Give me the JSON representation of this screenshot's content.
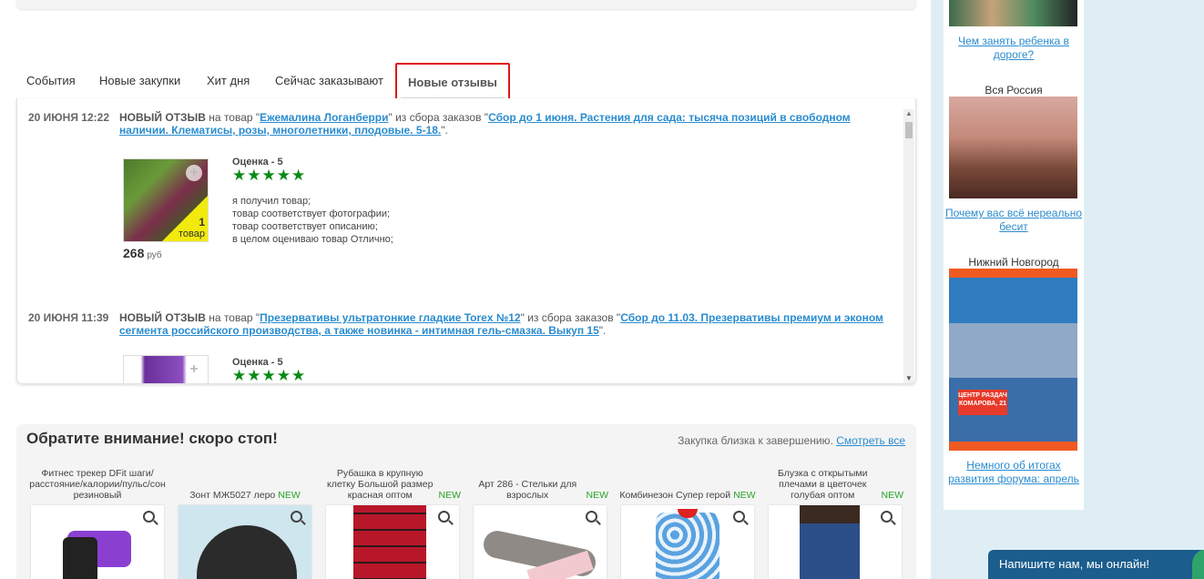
{
  "tabs": [
    {
      "label": "События"
    },
    {
      "label": "Новые закупки"
    },
    {
      "label": "Хит дня"
    },
    {
      "label": "Сейчас заказывают"
    },
    {
      "label": "Новые отзывы",
      "active": true
    }
  ],
  "reviews": [
    {
      "date": "20 ИЮНЯ 12:22",
      "prefix": "НОВЫЙ ОТЗЫВ",
      "on_product": " на товар \"",
      "product": "Ежемалина Логанберри",
      "from_collection": "\" из сбора заказов \"",
      "collection": "Сбор до 1 июня. Растения для сада: тысяча позиций в свободном наличии. Клематисы, розы, многолетники, плодовые. 5-18.",
      "end": "\".",
      "rating_label": "Оценка - 5",
      "stars": "★★★★★",
      "badge_count": "1",
      "badge_unit": "товар",
      "price": "268",
      "currency": "руб",
      "lines": [
        "я получил товар;",
        "товар соответствует фотографии;",
        "товар соответствует описанию;",
        "в целом оцениваю товар Отлично;"
      ]
    },
    {
      "date": "20 ИЮНЯ 11:39",
      "prefix": "НОВЫЙ ОТЗЫВ",
      "on_product": " на товар \"",
      "product": "Презервативы ультратонкие гладкие Torex №12",
      "from_collection": "\" из сбора заказов \"",
      "collection": "Сбор до 11.03. Презервативы премиум и эконом сегмента российского производства, а также новинка - интимная гель-смазка. Выкуп 15",
      "end": "\".",
      "rating_label": "Оценка - 5",
      "stars": "★★★★★"
    }
  ],
  "stop_section": {
    "title": "Обратите внимание! скоро стоп!",
    "hint": "Закупка близка к завершению.",
    "hint_link": "Смотреть все",
    "new_label": "NEW",
    "cards": [
      {
        "caption": "Фитнес трекер DFit шаги/расстояние/калории/пульс/сон резиновый",
        "is_new": false,
        "color": "#8a3fd1"
      },
      {
        "caption": "Зонт МЖ5027 леро",
        "is_new": true,
        "color": "#2b2b2b"
      },
      {
        "caption": "Рубашка в крупную клетку Большой размер красная оптом",
        "is_new": true,
        "color": "#b8172a"
      },
      {
        "caption": "Арт 286 - Стельки для взрослых",
        "is_new": true,
        "color": "#8f8a86"
      },
      {
        "caption": "Комбинезон Супер герой",
        "is_new": true,
        "color": "#5aa2e0"
      },
      {
        "caption": "Блузка с открытыми плечами в цветочек голубая оптом",
        "is_new": true,
        "color": "#2c4f8a"
      }
    ]
  },
  "sidebar": {
    "items": [
      {
        "region": "",
        "link": "Чем занять ребенка в дороге?"
      },
      {
        "region": "Вся Россия",
        "link": "Почему вас всё нереально бесит"
      },
      {
        "region": "Нижний Новгород",
        "link": "Немного об итогах развития форума: апрель",
        "ad_text": "ЦЕНТР РАЗДАЧ КОМАРОВА, 21"
      }
    ]
  },
  "chat": {
    "label": "Напишите нам, мы онлайн!"
  }
}
